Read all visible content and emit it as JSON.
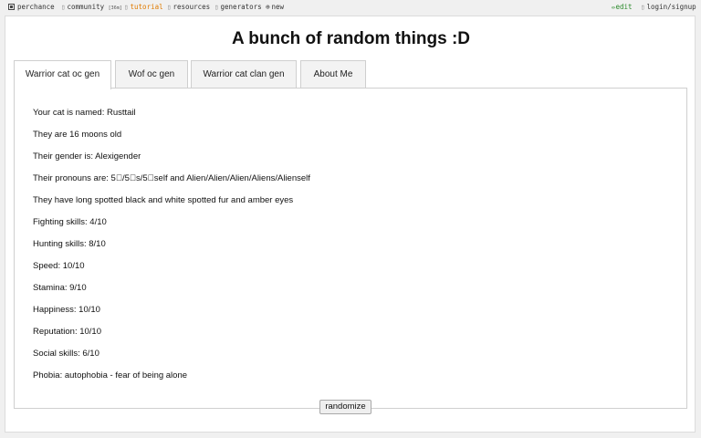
{
  "topbar": {
    "brand": "perchance",
    "community": "community",
    "community_badge": "[36m]",
    "tutorial": "tutorial",
    "resources": "resources",
    "generators": "generators",
    "new": "new",
    "edit": "edit",
    "login": "login/signup",
    "colors": {
      "tutorial": "#e07b00",
      "edit": "#2a8a2a"
    }
  },
  "page": {
    "title": "A bunch of random things :D"
  },
  "tabs": [
    {
      "label": "Warrior cat oc gen",
      "active": true
    },
    {
      "label": "Wof oc gen",
      "active": false
    },
    {
      "label": "Warrior cat clan gen",
      "active": false
    },
    {
      "label": "About Me",
      "active": false
    }
  ],
  "output": {
    "lines": [
      "Your cat is named: Rusttail",
      "They are 16 moons old",
      "Their gender is: Alexigender",
      "Their pronouns are: 5⃞/5⃞s/5⃞self and Alien/Alien/Alien/Aliens/Alienself",
      "They have long spotted black and white spotted fur and amber eyes",
      "Fighting skills: 4/10",
      "Hunting skills: 8/10",
      "Speed: 10/10",
      "Stamina: 9/10",
      "Happiness: 10/10",
      "Reputation: 10/10",
      "Social skills: 6/10",
      "Phobia: autophobia - fear of being alone"
    ]
  },
  "controls": {
    "randomize_label": "randomize"
  }
}
